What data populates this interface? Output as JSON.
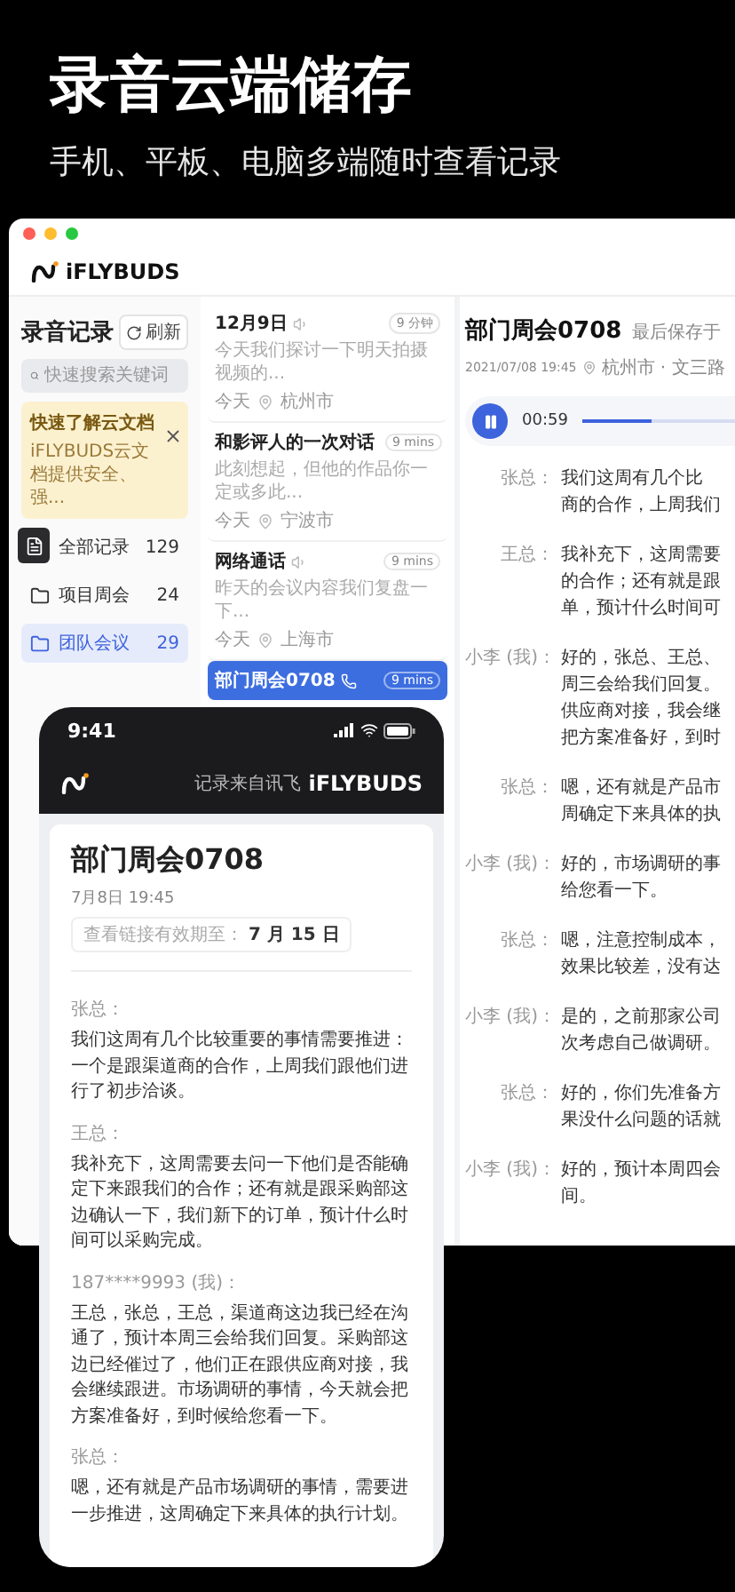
{
  "hero": {
    "title": "录音云端储存",
    "subtitle": "手机、平板、电脑多端随时查看记录"
  },
  "desktop": {
    "brand": "iFLYBUDS",
    "sidebar": {
      "title": "录音记录",
      "refresh": "刷新",
      "search": {
        "placeholder": "快速搜索关键词"
      },
      "banner": {
        "title": "快速了解云文档",
        "text": "iFLYBUDS云文档提供安全、强..."
      },
      "folders": [
        {
          "label": "全部记录",
          "count": "129",
          "selected": false
        },
        {
          "label": "项目周会",
          "count": "24",
          "selected": false
        },
        {
          "label": "团队会议",
          "count": "29",
          "selected": true
        }
      ]
    },
    "records": [
      {
        "title": "12月9日",
        "kind": "audio",
        "duration": "9 分钟",
        "snippet": "今天我们探讨一下明天拍摄视频的...",
        "day": "今天",
        "city": "杭州市",
        "selected": false
      },
      {
        "title": "和影评人的一次对话",
        "kind": "audio",
        "duration": "9 mins",
        "snippet": "此刻想起，但他的作品你一定或多此...",
        "day": "今天",
        "city": "宁波市",
        "selected": false
      },
      {
        "title": "网络通话",
        "kind": "audio",
        "duration": "9 mins",
        "snippet": "昨天的会议内容我们复盘一下...",
        "day": "今天",
        "city": "上海市",
        "selected": false
      },
      {
        "title": "部门周会0708",
        "kind": "call",
        "duration": "9 mins",
        "selected": true
      }
    ],
    "detail": {
      "title": "部门周会0708",
      "saved": "最后保存于",
      "date": "2021/07/08 19:45",
      "place": "杭州市 · 文三路",
      "player": {
        "time": "00:59",
        "level": 0.45
      },
      "transcript": [
        {
          "speaker": "张总：",
          "lines": [
            "我们这周有几个比",
            "商的合作，上周我们"
          ]
        },
        {
          "speaker": "王总：",
          "lines": [
            "我补充下，这周需要",
            "的合作；还有就是跟",
            "单，预计什么时间可"
          ]
        },
        {
          "speaker": "小李 (我)：",
          "lines": [
            "好的，张总、王总、",
            "周三会给我们回复。",
            "供应商对接，我会继",
            "把方案准备好，到时"
          ]
        },
        {
          "speaker": "张总：",
          "lines": [
            "嗯，还有就是产品市",
            "周确定下来具体的执"
          ]
        },
        {
          "speaker": "小李 (我)：",
          "lines": [
            "好的，市场调研的事",
            "给您看一下。"
          ]
        },
        {
          "speaker": "张总：",
          "lines": [
            "嗯，注意控制成本，",
            "效果比较差，没有达"
          ]
        },
        {
          "speaker": "小李 (我)：",
          "lines": [
            "是的，之前那家公司",
            "次考虑自己做调研。"
          ]
        },
        {
          "speaker": "张总：",
          "lines": [
            "好的，你们先准备方",
            "果没什么问题的话就"
          ]
        },
        {
          "speaker": "小李 (我)：",
          "lines": [
            "好的，预计本周四会",
            "间。"
          ]
        }
      ]
    }
  },
  "phone": {
    "time": "9:41",
    "source": "记录来自讯飞",
    "brand": "iFLYBUDS",
    "title": "部门周会0708",
    "date": "7月8日 19:45",
    "expiry": {
      "label": "查看链接有效期至：",
      "value": "7 月 15 日"
    },
    "transcript": [
      {
        "speaker": "张总：",
        "text": "我们这周有几个比较重要的事情需要推进：一个是跟渠道商的合作，上周我们跟他们进行了初步洽谈。"
      },
      {
        "speaker": "王总：",
        "text": "我补充下，这周需要去问一下他们是否能确定下来跟我们的合作；还有就是跟采购部这边确认一下，我们新下的订单，预计什么时间可以采购完成。"
      },
      {
        "speaker": "187****9993 (我)：",
        "text": "王总，张总，王总，渠道商这边我已经在沟通了，预计本周三会给我们回复。采购部这边已经催过了，他们正在跟供应商对接，我会继续跟进。市场调研的事情，今天就会把方案准备好，到时候给您看一下。"
      },
      {
        "speaker": "张总：",
        "text": "嗯，还有就是产品市场调研的事情，需要进一步推进，这周确定下来具体的执行计划。"
      }
    ]
  }
}
